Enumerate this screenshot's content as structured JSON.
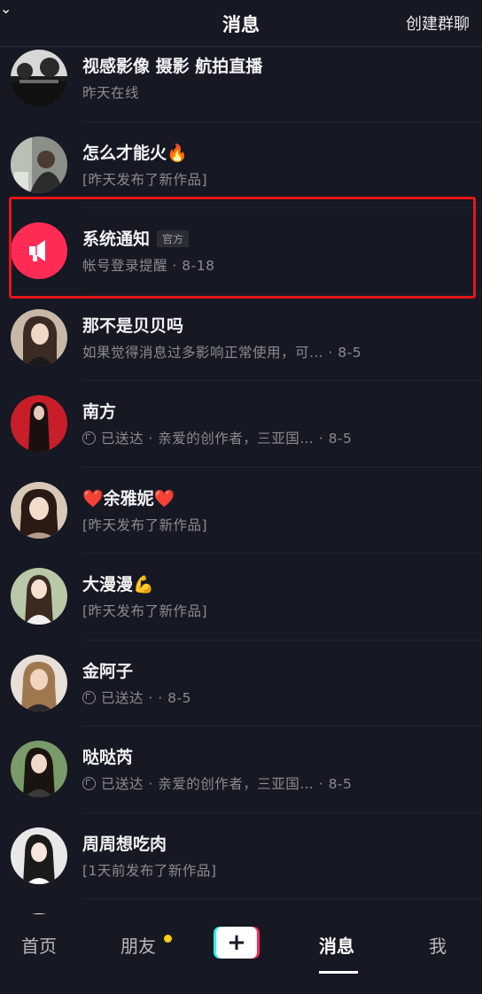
{
  "header": {
    "title": "消息",
    "create_group": "创建群聊",
    "pull_indicator": "⌄"
  },
  "conversations": [
    {
      "name": "视感影像  摄影 航拍直播",
      "subtitle": "昨天在线",
      "avatar_icon": "landscape-avatar"
    },
    {
      "name": "怎么才能火🔥",
      "subtitle": "[昨天发布了新作品]",
      "avatar_icon": "user-avatar"
    },
    {
      "name": "系统通知",
      "badge": "官方",
      "subtitle": "帐号登录提醒 · 8-18",
      "avatar_icon": "megaphone-icon"
    },
    {
      "name": "那不是贝贝吗",
      "subtitle": "如果觉得消息过多影响正常使用，可… · 8-5",
      "avatar_icon": "user-avatar"
    },
    {
      "name": "南方",
      "subtitle": "已送达 · 亲爱的创作者，三亚国… · 8-5",
      "avatar_icon": "user-avatar"
    },
    {
      "name": "❤️余雅妮❤️",
      "subtitle": "[昨天发布了新作品]",
      "avatar_icon": "user-avatar"
    },
    {
      "name": "大漫漫💪",
      "subtitle": "[昨天发布了新作品]",
      "avatar_icon": "user-avatar"
    },
    {
      "name": "金阿子",
      "subtitle": "已送达 · · 8-5",
      "avatar_icon": "user-avatar"
    },
    {
      "name": "哒哒芮",
      "subtitle": "已送达 · 亲爱的创作者，三亚国… · 8-5",
      "avatar_icon": "user-avatar"
    },
    {
      "name": "周周想吃肉",
      "subtitle": "[1天前发布了新作品]",
      "avatar_icon": "user-avatar"
    }
  ],
  "bottom_nav": {
    "home": "首页",
    "friends": "朋友",
    "create": "+",
    "messages": "消息",
    "me": "我"
  },
  "colors": {
    "background": "#161823",
    "accent": "#fe2c55",
    "highlight": "#e3161a",
    "notification_dot": "#face15"
  }
}
